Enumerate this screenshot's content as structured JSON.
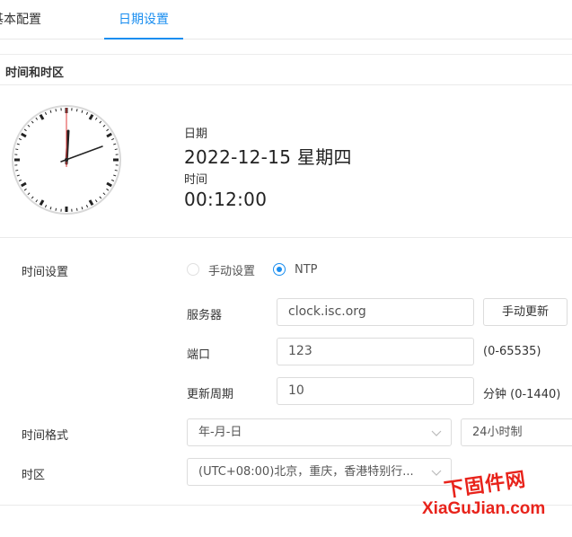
{
  "tabs": [
    {
      "label": "基本配置",
      "active": false
    },
    {
      "label": "日期设置",
      "active": true
    }
  ],
  "section": {
    "title": "时间和时区"
  },
  "clock_display": {
    "date_label": "日期",
    "date_value": "2022-12-15 星期四",
    "time_label": "时间",
    "time_value": "00:12:00"
  },
  "form": {
    "time_setting": {
      "label": "时间设置",
      "options": [
        "手动设置",
        "NTP"
      ],
      "selected": "NTP"
    },
    "server": {
      "label": "服务器",
      "value": "clock.isc.org",
      "button": "手动更新"
    },
    "port": {
      "label": "端口",
      "value": "123",
      "hint": "(0-65535)"
    },
    "period": {
      "label": "更新周期",
      "value": "10",
      "hint": "分钟 (0-1440)"
    },
    "time_format": {
      "label": "时间格式",
      "date_format": "年-月-日",
      "hour_format": "24小时制"
    },
    "timezone": {
      "label": "时区",
      "value": "(UTC+08:00)北京，重庆，香港特别行..."
    }
  },
  "watermark": {
    "top": "下固件网",
    "bottom": "XiaGuJian.com"
  },
  "colors": {
    "accent": "#1a8ef0",
    "watermark": "#e8231b",
    "border": "#dcdcdc"
  },
  "icons": {
    "select_arrow": "chevron-down-icon"
  }
}
